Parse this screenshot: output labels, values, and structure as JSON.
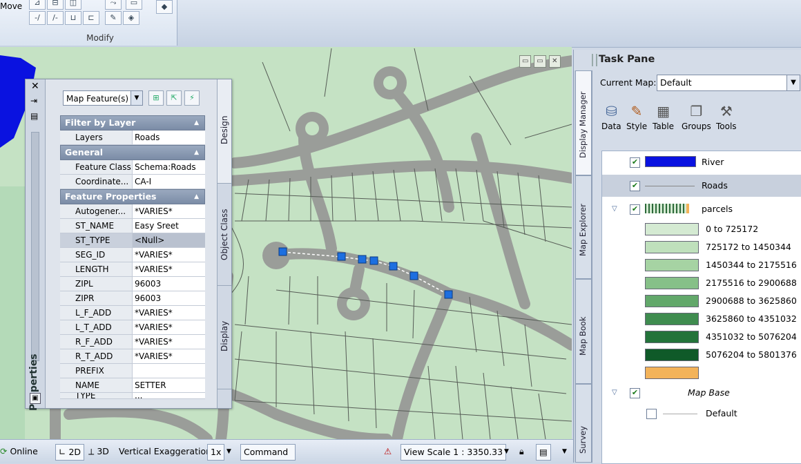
{
  "ribbon": {
    "left_label": "Move",
    "modify_label": "Modify"
  },
  "map": {
    "window_controls": [
      "▭",
      "▭",
      "✕"
    ]
  },
  "properties": {
    "panel_title": "Properties",
    "selector": "Map Feature(s)",
    "filter_section": "Filter by Layer",
    "layers_key": "Layers",
    "layers_value": "Roads",
    "general_section": "General",
    "general_rows": [
      {
        "k": "Feature Class",
        "v": "Schema:Roads"
      },
      {
        "k": "Coordinate...",
        "v": "CA-I"
      }
    ],
    "feature_section": "Feature Properties",
    "feature_rows": [
      {
        "k": "Autogener...",
        "v": "*VARIES*"
      },
      {
        "k": "ST_NAME",
        "v": "Easy Sreet"
      },
      {
        "k": "ST_TYPE",
        "v": "<Null>"
      },
      {
        "k": "SEG_ID",
        "v": "*VARIES*"
      },
      {
        "k": "LENGTH",
        "v": "*VARIES*"
      },
      {
        "k": "ZIPL",
        "v": "96003"
      },
      {
        "k": "ZIPR",
        "v": "96003"
      },
      {
        "k": "L_F_ADD",
        "v": "*VARIES*"
      },
      {
        "k": "L_T_ADD",
        "v": "*VARIES*"
      },
      {
        "k": "R_F_ADD",
        "v": "*VARIES*"
      },
      {
        "k": "R_T_ADD",
        "v": "*VARIES*"
      },
      {
        "k": "PREFIX",
        "v": ""
      },
      {
        "k": "NAME",
        "v": "SETTER"
      },
      {
        "k": "TYPE",
        "v": "..."
      }
    ],
    "side_tabs": [
      "Design",
      "Object Class",
      "Display"
    ]
  },
  "status": {
    "online": "Online",
    "mode2d": "2D",
    "mode3d": "3D",
    "vert_label": "Vertical Exaggeration:",
    "vert_value": "1x",
    "command": "Command",
    "viewscale_label": "View Scale",
    "viewscale_sep": "1 :",
    "viewscale_value": "3350.33"
  },
  "task": {
    "title": "Task Pane",
    "current_map_label": "Current Map:",
    "current_map_value": "Default",
    "tools": [
      "Data",
      "Style",
      "Table",
      "Groups",
      "Tools"
    ],
    "vertical_tabs": [
      "Display Manager",
      "Map Explorer",
      "Map Book",
      "Survey"
    ],
    "layers": {
      "river": "River",
      "roads": "Roads",
      "parcels": "parcels",
      "ranges": [
        {
          "label": "0 to 725172",
          "color": "#d4ead2"
        },
        {
          "label": "725172 to 1450344",
          "color": "#bfe0bc"
        },
        {
          "label": "1450344 to 2175516",
          "color": "#a6d3a3"
        },
        {
          "label": "2175516 to 2900688",
          "color": "#86c088"
        },
        {
          "label": "2900688 to 3625860",
          "color": "#62a86a"
        },
        {
          "label": "3625860 to 4351032",
          "color": "#3f8c4f"
        },
        {
          "label": "4351032 to 5076204",
          "color": "#23733a"
        },
        {
          "label": "5076204 to 5801376",
          "color": "#0f5a29"
        },
        {
          "label": "",
          "color": "#f3b35a"
        }
      ],
      "map_base": "Map Base",
      "default": "Default"
    },
    "colors": {
      "river": "#0a12e0",
      "check": "#1a7a1a"
    }
  }
}
